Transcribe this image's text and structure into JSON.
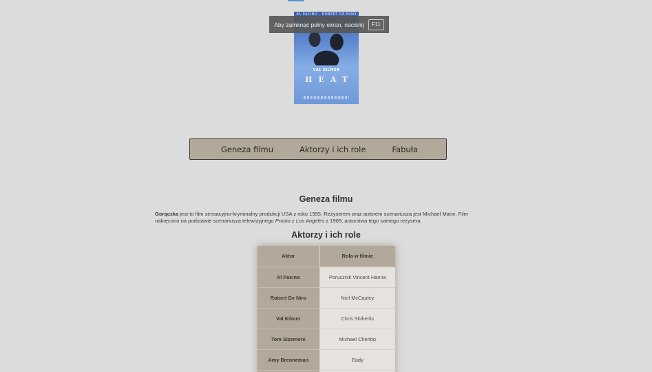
{
  "fullscreen_toast": {
    "message": "Aby zamknąć pełny ekran, naciśnij",
    "key": "F11"
  },
  "poster": {
    "actors_line": "AL PACINO · ROBERT DE NIRO",
    "kilmer": "VAL KILMER",
    "title": "HEAT"
  },
  "nav": {
    "items": [
      "Geneza filmu",
      "Aktorzy i ich role",
      "Fabuła"
    ]
  },
  "genesis": {
    "heading": "Geneza filmu",
    "film_name": "Gorączka",
    "text_part1": " jest to film sensacyjno-kryminalny produkcji USA z roku 1995. Reżyserem oraz autorem scenariusza jest Michael Mann. Film nakręcono na podstawie scenariusza telewizyjnego ",
    "tv_title": "Prosto z Los Angeles",
    "text_part2": " z 1989, autorstwa tego samego reżysera."
  },
  "actors": {
    "heading": "Aktorzy i ich role",
    "columns": [
      "Aktor",
      "Rola w filmie"
    ],
    "rows": [
      {
        "actor": "Al Pacino",
        "role": "Porucznik Vincent Hanna"
      },
      {
        "actor": "Robert De Niro",
        "role": "Neil McCauley"
      },
      {
        "actor": "Val Kilmer",
        "role": "Chris Shiherlis"
      },
      {
        "actor": "Tom Sizemore",
        "role": "Michael Cheritto"
      },
      {
        "actor": "Amy Brenneman",
        "role": "Eady"
      },
      {
        "actor": "",
        "role": ""
      }
    ]
  },
  "colors": {
    "background": "#dcdcdc",
    "nav_bg": "#b3a99a",
    "table_header": "#b3a99a",
    "table_cell": "#e6e3de"
  }
}
